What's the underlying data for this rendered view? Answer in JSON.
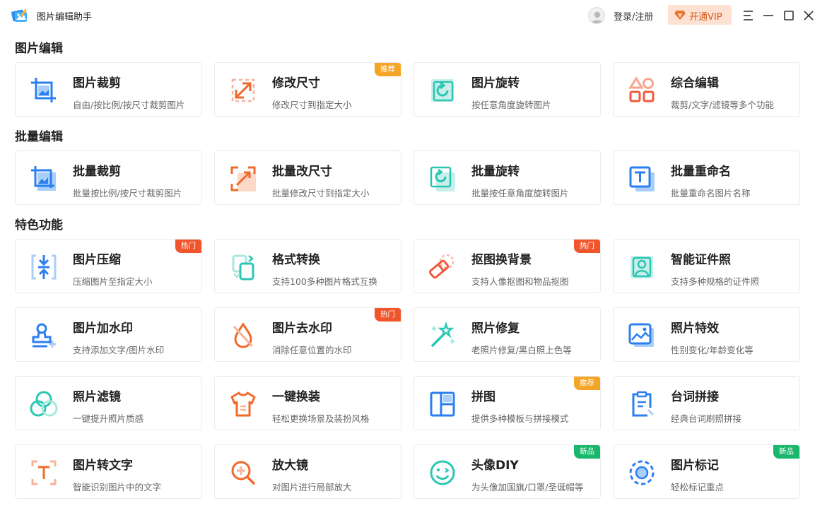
{
  "app": {
    "title": "图片编辑助手"
  },
  "header": {
    "login_label": "登录/注册",
    "vip_label": "开通VIP"
  },
  "colors": {
    "blue": "#2b7ff0",
    "orange": "#f06a2b",
    "teal": "#2bc6b4",
    "red": "#ef5a3c",
    "hot": "#f0552b",
    "recommend": "#f5a526",
    "new": "#19b76b"
  },
  "sections": [
    {
      "title": "图片编辑",
      "cards": [
        {
          "title": "图片裁剪",
          "sub": "自由/按比例/按尺寸裁剪图片",
          "icon": "crop-icon"
        },
        {
          "title": "修改尺寸",
          "sub": "修改尺寸到指定大小",
          "icon": "resize-icon",
          "badge": "推荐"
        },
        {
          "title": "图片旋转",
          "sub": "按任意角度旋转图片",
          "icon": "rotate-icon"
        },
        {
          "title": "综合编辑",
          "sub": "裁剪/文字/滤镜等多个功能",
          "icon": "shapes-icon"
        }
      ]
    },
    {
      "title": "批量编辑",
      "cards": [
        {
          "title": "批量裁剪",
          "sub": "批量按比例/按尺寸裁剪图片",
          "icon": "batch-crop-icon"
        },
        {
          "title": "批量改尺寸",
          "sub": "批量修改尺寸到指定大小",
          "icon": "batch-resize-icon"
        },
        {
          "title": "批量旋转",
          "sub": "批量按任意角度旋转图片",
          "icon": "batch-rotate-icon"
        },
        {
          "title": "批量重命名",
          "sub": "批量重命名图片名称",
          "icon": "batch-rename-icon"
        }
      ]
    },
    {
      "title": "特色功能",
      "cards": [
        {
          "title": "图片压缩",
          "sub": "压缩图片至指定大小",
          "icon": "compress-icon",
          "badge": "热门"
        },
        {
          "title": "格式转换",
          "sub": "支持100多种图片格式互换",
          "icon": "convert-icon"
        },
        {
          "title": "抠图换背景",
          "sub": "支持人像抠图和物品抠图",
          "icon": "eraser-icon",
          "badge": "热门"
        },
        {
          "title": "智能证件照",
          "sub": "支持多种规格的证件照",
          "icon": "id-photo-icon"
        },
        {
          "title": "图片加水印",
          "sub": "支持添加文字/图片水印",
          "icon": "stamp-icon"
        },
        {
          "title": "图片去水印",
          "sub": "消除任意位置的水印",
          "icon": "drop-off-icon",
          "badge": "热门"
        },
        {
          "title": "照片修复",
          "sub": "老照片修复/黑白照上色等",
          "icon": "magic-wand-icon"
        },
        {
          "title": "照片特效",
          "sub": "性别变化/年龄变化等",
          "icon": "landscape-icon"
        },
        {
          "title": "照片滤镜",
          "sub": "一键提升照片质感",
          "icon": "filter-icon"
        },
        {
          "title": "一键换装",
          "sub": "轻松更换场景及装扮风格",
          "icon": "shirt-icon"
        },
        {
          "title": "拼图",
          "sub": "提供多种模板与拼接模式",
          "icon": "collage-icon",
          "badge": "推荐"
        },
        {
          "title": "台词拼接",
          "sub": "经典台词刷照拼接",
          "icon": "clipboard-icon"
        },
        {
          "title": "图片转文字",
          "sub": "智能识别图片中的文字",
          "icon": "ocr-icon"
        },
        {
          "title": "放大镜",
          "sub": "对图片进行局部放大",
          "icon": "magnifier-icon"
        },
        {
          "title": "头像DIY",
          "sub": "为头像加国旗/口罩/圣诞帽等",
          "icon": "smile-icon",
          "badge": "新品"
        },
        {
          "title": "图片标记",
          "sub": "轻松标记重点",
          "icon": "mark-icon",
          "badge": "新品"
        }
      ]
    }
  ]
}
